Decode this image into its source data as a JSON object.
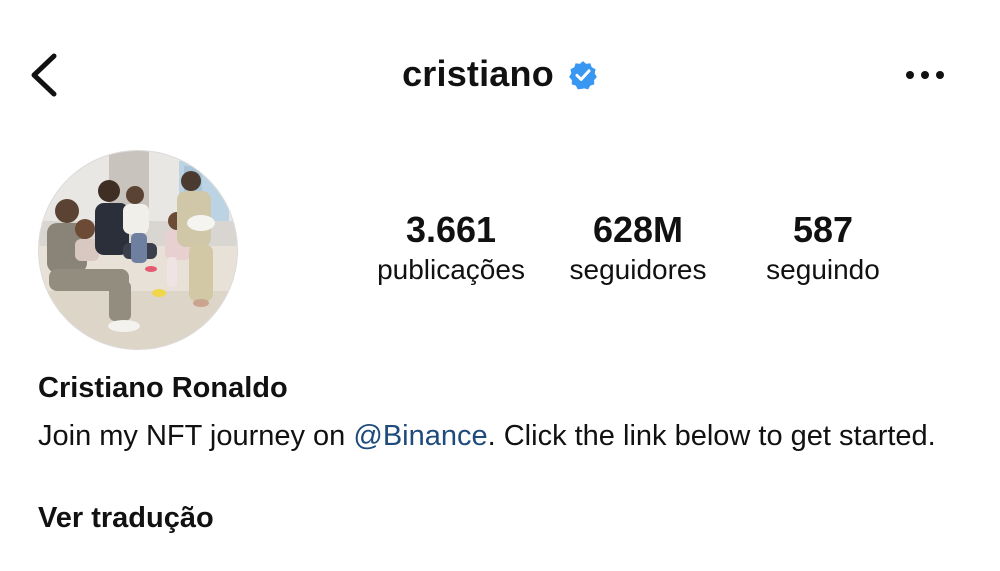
{
  "header": {
    "username": "cristiano",
    "back_icon": "chevron-left-icon",
    "verified_icon": "verified-badge-icon",
    "more_icon": "more-horizontal-icon"
  },
  "profile": {
    "avatar_alt": "profile-photo",
    "stats": {
      "posts": {
        "count": "3.661",
        "label": "publicações"
      },
      "followers": {
        "count": "628M",
        "label": "seguidores"
      },
      "following": {
        "count": "587",
        "label": "seguindo"
      }
    },
    "display_name": "Cristiano Ronaldo",
    "bio": {
      "prefix": "Join my NFT journey on ",
      "mention": "@Binance",
      "suffix": ". Click the link below to get started."
    },
    "translate_label": "Ver tradução"
  },
  "colors": {
    "verified_blue": "#3897f0",
    "mention_link": "#1f4b7a",
    "text_primary": "#111111"
  }
}
